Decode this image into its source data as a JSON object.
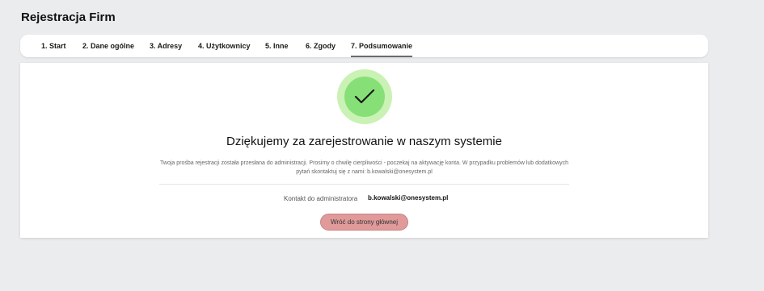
{
  "header": {
    "title": "Rejestracja Firm"
  },
  "steps": [
    {
      "label": "1. Start"
    },
    {
      "label": "2. Dane ogólne"
    },
    {
      "label": "3. Adresy"
    },
    {
      "label": "4. Użytkownicy"
    },
    {
      "label": "5. Inne"
    },
    {
      "label": "6. Zgody"
    },
    {
      "label": "7. Podsumowanie"
    }
  ],
  "active_step": "7. Podsumowanie",
  "summary": {
    "icon": "checkmark-icon",
    "heading": "Dziękujemy za zarejestrowanie w naszym systemie",
    "message": "Twoja prośba rejestracji została przesłana do administracji. Prosimy o chwilę cierpliwości - poczekaj na aktywację konta. W przypadku problemów lub dodatkowych pytań skontaktuj się z nami: b.kowalski@onesystem.pl",
    "contact_label": "Kontakt do administratora",
    "contact_email": "b.kowalski@onesystem.pl",
    "button_label": "Wróć do strony głównej"
  },
  "colors": {
    "background": "#ebecee",
    "success_outer": "#c9f2b4",
    "success_inner": "#86e077",
    "button": "#e09a9a",
    "active_step_underline": "#6b6b6b"
  }
}
